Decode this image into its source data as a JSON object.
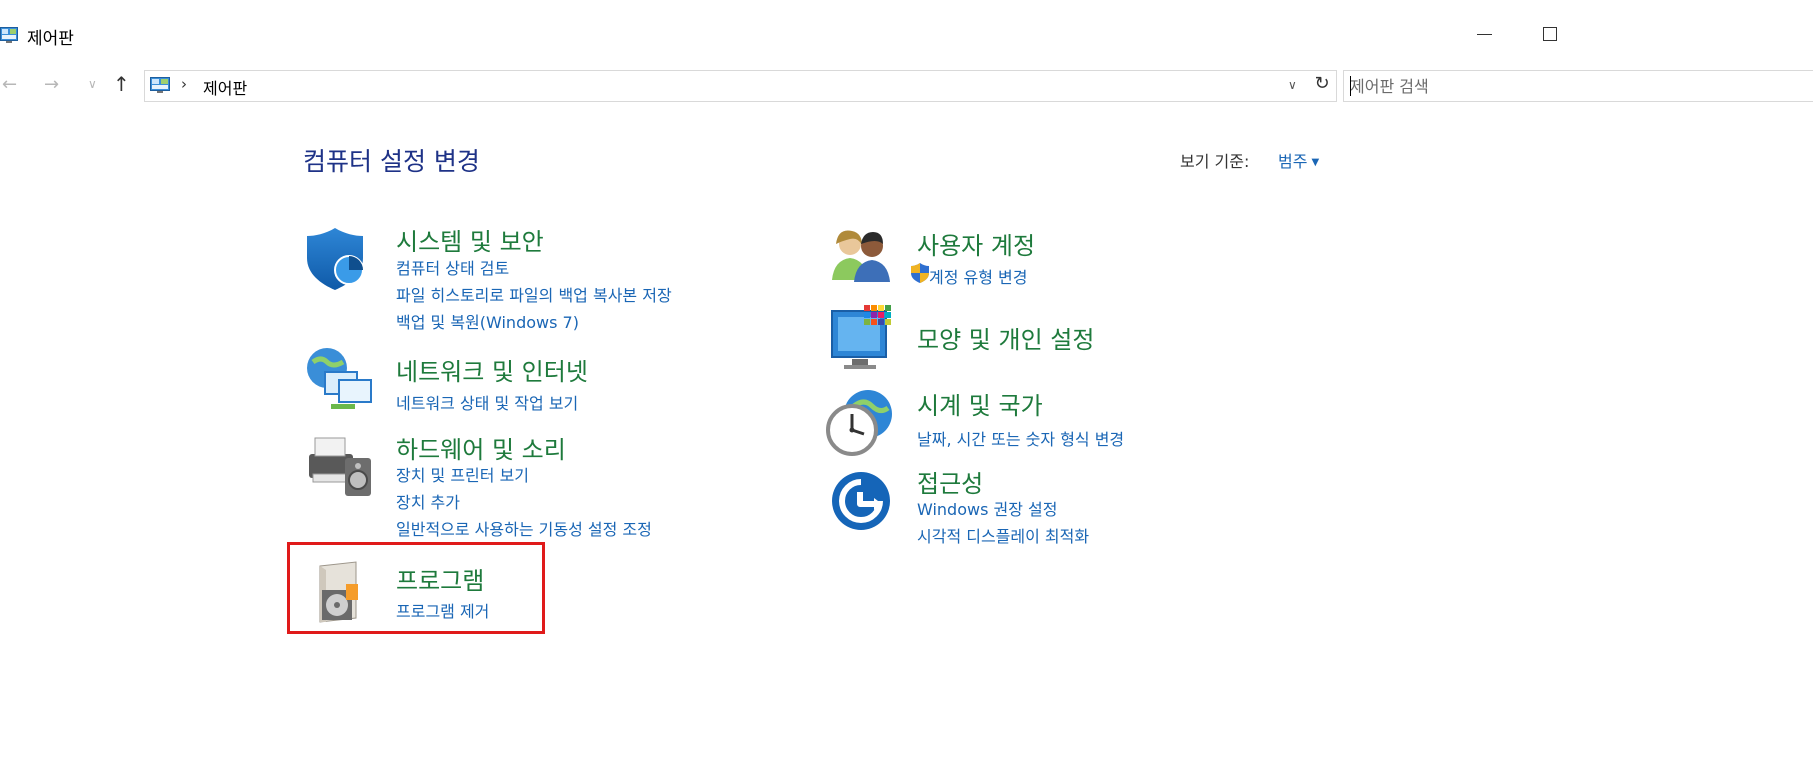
{
  "window": {
    "title": "제어판"
  },
  "address_bar": {
    "breadcrumb": "제어판",
    "separator": "›",
    "search_placeholder": "제어판 검색"
  },
  "header": {
    "title": "컴퓨터 설정 변경",
    "view_by_label": "보기 기준:",
    "view_by_value": "범주"
  },
  "categories": {
    "system_security": {
      "title": "시스템 및 보안",
      "links": [
        "컴퓨터 상태 검토",
        "파일 히스토리로 파일의 백업 복사본 저장",
        "백업 및 복원(Windows 7)"
      ]
    },
    "network": {
      "title": "네트워크 및 인터넷",
      "links": [
        "네트워크 상태 및 작업 보기"
      ]
    },
    "hardware": {
      "title": "하드웨어 및 소리",
      "links": [
        "장치 및 프린터 보기",
        "장치 추가",
        "일반적으로 사용하는 기동성 설정 조정"
      ]
    },
    "programs": {
      "title": "프로그램",
      "links": [
        "프로그램 제거"
      ]
    },
    "user_accounts": {
      "title": "사용자 계정",
      "links": [
        "계정 유형 변경"
      ]
    },
    "appearance": {
      "title": "모양 및 개인 설정",
      "links": []
    },
    "clock_region": {
      "title": "시계 및 국가",
      "links": [
        "날짜, 시간 또는 숫자 형식 변경"
      ]
    },
    "ease_of_access": {
      "title": "접근성",
      "links": [
        "Windows 권장 설정",
        "시각적 디스플레이 최적화"
      ]
    }
  },
  "colors": {
    "category_title": "#1e7a3c",
    "link": "#1a66b5",
    "page_title": "#1e3287",
    "highlight_box": "#e01a1a"
  }
}
